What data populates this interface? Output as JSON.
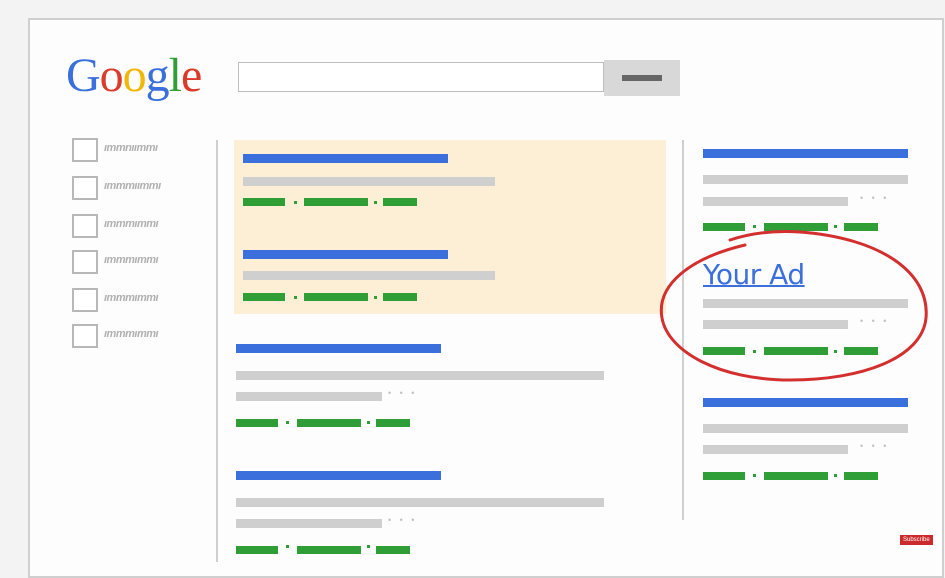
{
  "logo": {
    "letters": [
      {
        "ch": "G",
        "color": "#3b6fdc"
      },
      {
        "ch": "o",
        "color": "#db3b2b"
      },
      {
        "ch": "o",
        "color": "#f2b705"
      },
      {
        "ch": "g",
        "color": "#3b6fdc"
      },
      {
        "ch": "l",
        "color": "#2f9e37"
      },
      {
        "ch": "e",
        "color": "#db3b2b"
      }
    ]
  },
  "search": {
    "value": "",
    "placeholder": ""
  },
  "filters": [
    {
      "label": "ımmnıımmı"
    },
    {
      "label": "ımmmıımmı"
    },
    {
      "label": "ımmmımmı"
    },
    {
      "label": "ımmmımmı"
    },
    {
      "label": "ımmmımmı"
    },
    {
      "label": "ımmmımmı"
    }
  ],
  "ad": {
    "title": "Your Ad",
    "circle_color": "#d32f2f"
  },
  "subscribe": {
    "label": "Subscribe"
  },
  "colors": {
    "blue": "#3b6fdc",
    "green": "#2f9e37",
    "gray": "#cfcfcf",
    "highlight": "#fdeed6"
  }
}
